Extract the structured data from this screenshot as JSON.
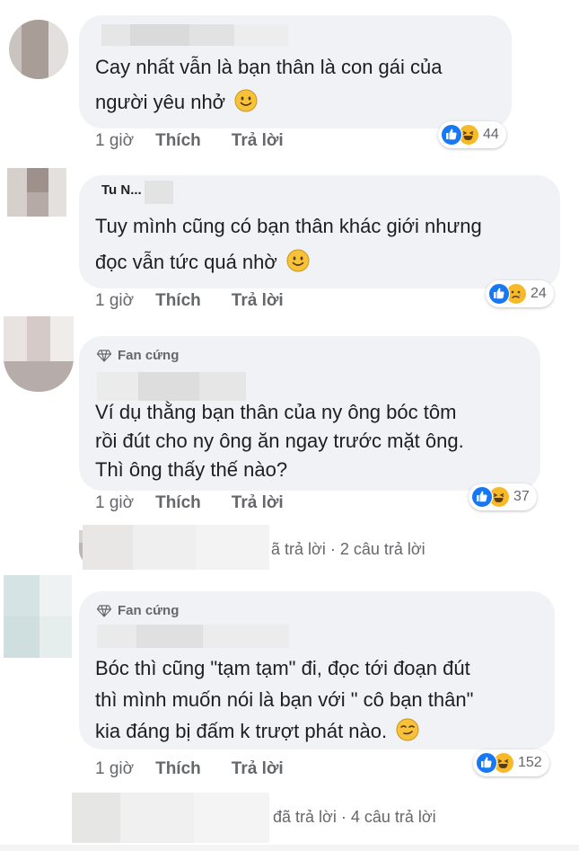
{
  "comments": [
    {
      "lines": [
        "Cay nhất vẫn là bạn thân là con gái của",
        "người yêu nhở"
      ],
      "time": "1 giờ",
      "like": "Thích",
      "reply": "Trả lời",
      "reaction_icons": [
        "like-icon",
        "haha-icon"
      ],
      "reaction_count": "44"
    },
    {
      "name_fragment": "Tu N...",
      "lines": [
        "Tuy mình cũng có bạn thân khác giới nhưng",
        "đọc vẫn tức quá nhờ"
      ],
      "time": "1 giờ",
      "like": "Thích",
      "reply": "Trả lời",
      "reaction_icons": [
        "like-icon",
        "sad-icon"
      ],
      "reaction_count": "24"
    },
    {
      "badge": "Fan cứng",
      "lines": [
        "Ví dụ thằng bạn thân của ny ông bóc tôm",
        "rồi đút cho ny ông ăn ngay trước mặt ông.",
        "Thì ông thấy thế nào?"
      ],
      "time": "1 giờ",
      "like": "Thích",
      "reply": "Trả lời",
      "reaction_icons": [
        "like-icon",
        "haha-icon"
      ],
      "reaction_count": "37",
      "replies_text": "ã trả lời · 2 câu trả lời"
    },
    {
      "badge": "Fan cứng",
      "lines": [
        "Bóc thì cũng \"tạm tạm\" đi, đọc tới đoạn đút",
        "thì mình muốn nói là bạn với \" cô bạn thân\"",
        "kia đáng bị đấm k trượt phát nào."
      ],
      "time": "1 giờ",
      "like": "Thích",
      "reply": "Trả lời",
      "reaction_icons": [
        "like-icon",
        "haha-icon"
      ],
      "reaction_count": "152",
      "replies_text": "đã trả lời · 4 câu trả lời"
    }
  ],
  "colors": {
    "bubble": "#f0f2f5",
    "secondary_text": "#65676b",
    "like_blue": "#1877f2",
    "emoji_yellow": "#f7b928"
  }
}
